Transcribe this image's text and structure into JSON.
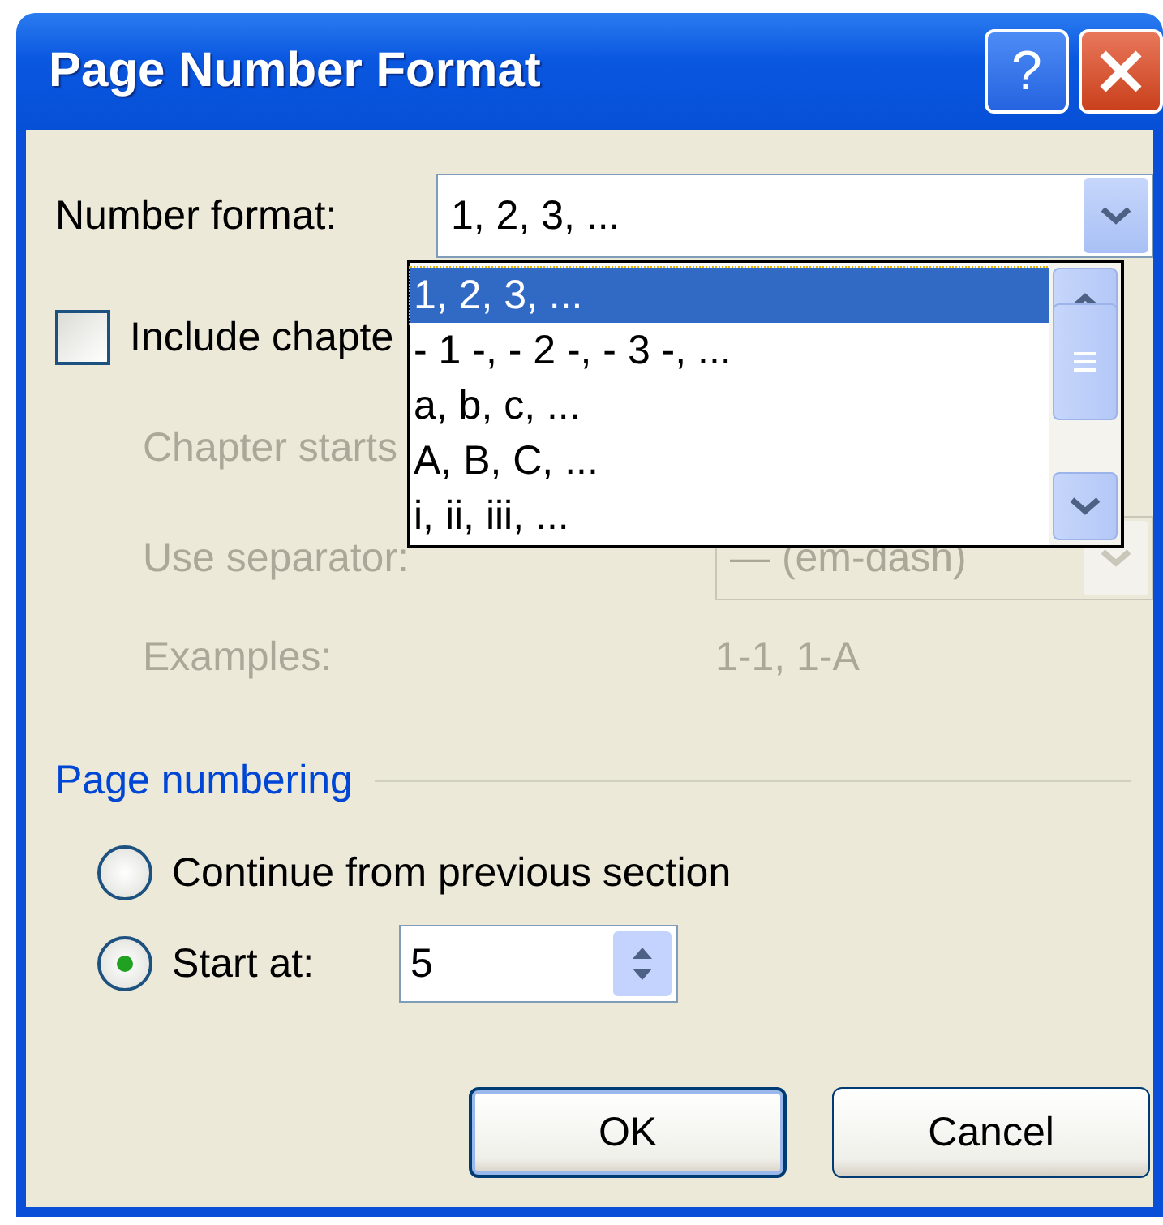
{
  "window": {
    "title": "Page Number Format",
    "help": "?"
  },
  "number_format": {
    "label": "Number format:",
    "value": "1, 2, 3, ...",
    "expanded": true,
    "options": [
      {
        "label": "1, 2, 3, ...",
        "selected": true
      },
      {
        "label": "- 1 -, - 2 -, - 3 -, ...",
        "selected": false
      },
      {
        "label": "a, b, c, ...",
        "selected": false
      },
      {
        "label": "A, B, C, ...",
        "selected": false
      },
      {
        "label": "i, ii, iii, ...",
        "selected": false
      }
    ]
  },
  "include_chapter_number": {
    "label": "Include chapte",
    "checked": false
  },
  "chapter_starts": {
    "label": "Chapter starts",
    "disabled": true
  },
  "use_separator": {
    "label": "Use separator:",
    "value": "— (em-dash)",
    "disabled": true
  },
  "examples": {
    "label": "Examples:",
    "value": "1-1, 1-A",
    "disabled": true
  },
  "page_numbering": {
    "title": "Page numbering",
    "options": [
      {
        "label": "Continue from previous section",
        "selected": false
      },
      {
        "label": "Start at:",
        "selected": true
      }
    ],
    "start_at": "5"
  },
  "buttons": [
    {
      "label": "OK",
      "default": true
    },
    {
      "label": "Cancel",
      "default": false
    }
  ]
}
